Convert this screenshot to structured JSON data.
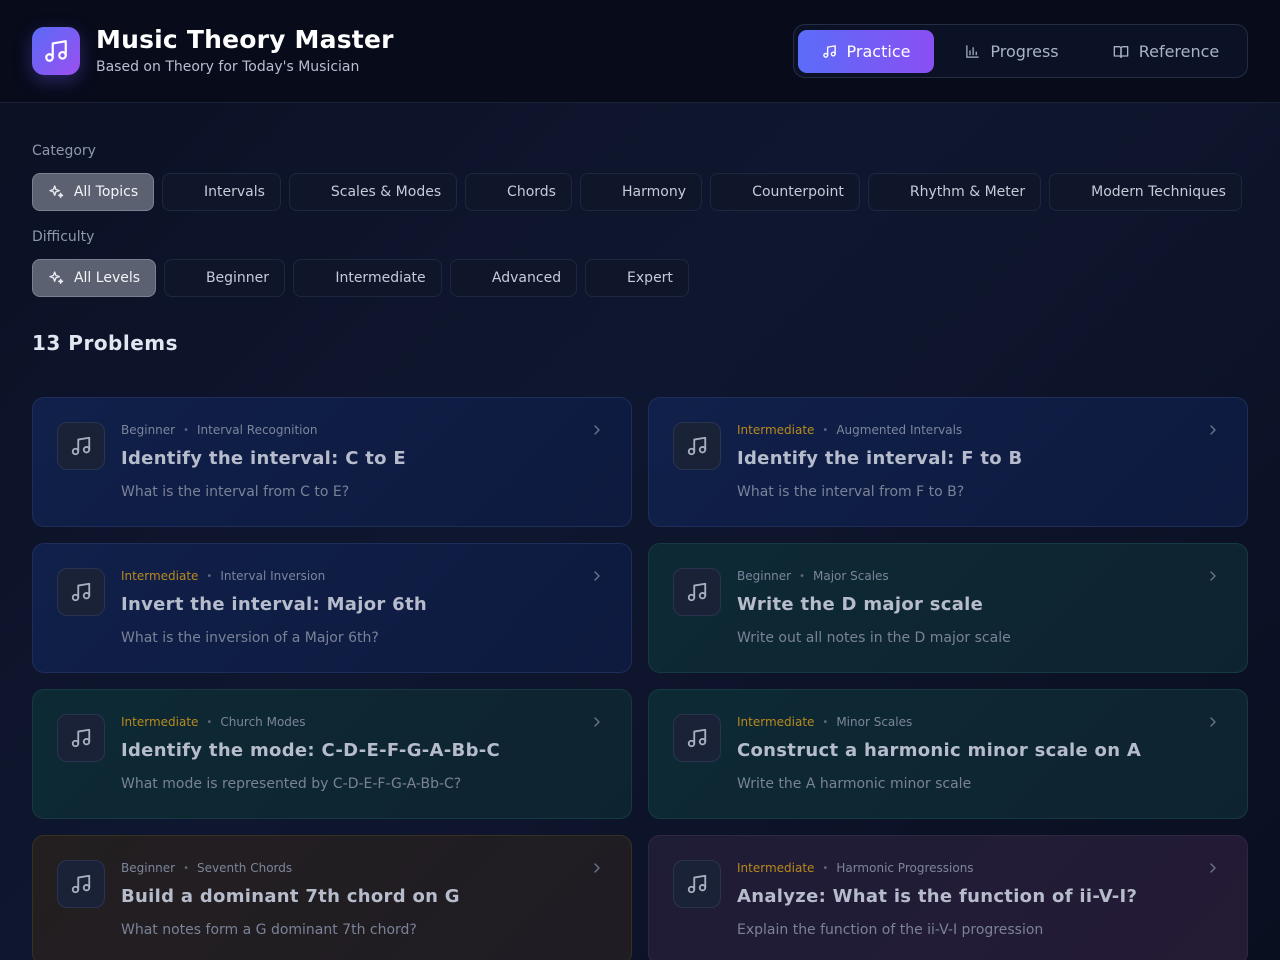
{
  "header": {
    "title": "Music Theory Master",
    "subtitle": "Based on Theory for Today's Musician",
    "logo_icon": "music-note-icon"
  },
  "nav": {
    "tabs": [
      {
        "label": "Practice",
        "icon": "music-note-icon",
        "active": true
      },
      {
        "label": "Progress",
        "icon": "bar-chart-icon",
        "active": false
      },
      {
        "label": "Reference",
        "icon": "book-icon",
        "active": false
      }
    ]
  },
  "filters": {
    "category_label": "Category",
    "categories": [
      {
        "label": "All Topics",
        "active": true
      },
      {
        "label": "Intervals",
        "active": false
      },
      {
        "label": "Scales & Modes",
        "active": false
      },
      {
        "label": "Chords",
        "active": false
      },
      {
        "label": "Harmony",
        "active": false
      },
      {
        "label": "Counterpoint",
        "active": false
      },
      {
        "label": "Rhythm & Meter",
        "active": false
      },
      {
        "label": "Modern Techniques",
        "active": false
      }
    ],
    "difficulty_label": "Difficulty",
    "levels": [
      {
        "label": "All Levels",
        "active": true
      },
      {
        "label": "Beginner",
        "active": false
      },
      {
        "label": "Intermediate",
        "active": false
      },
      {
        "label": "Advanced",
        "active": false
      },
      {
        "label": "Expert",
        "active": false
      }
    ]
  },
  "problems": {
    "count_label": "13 Problems",
    "items": [
      {
        "level": "Beginner",
        "topic": "Interval Recognition",
        "title": "Identify the interval: C to E",
        "desc": "What is the interval from C to E?",
        "theme": "blue"
      },
      {
        "level": "Intermediate",
        "topic": "Augmented Intervals",
        "title": "Identify the interval: F to B",
        "desc": "What is the interval from F to B?",
        "theme": "blue"
      },
      {
        "level": "Intermediate",
        "topic": "Interval Inversion",
        "title": "Invert the interval: Major 6th",
        "desc": "What is the inversion of a Major 6th?",
        "theme": "blue"
      },
      {
        "level": "Beginner",
        "topic": "Major Scales",
        "title": "Write the D major scale",
        "desc": "Write out all notes in the D major scale",
        "theme": "teal"
      },
      {
        "level": "Intermediate",
        "topic": "Church Modes",
        "title": "Identify the mode: C-D-E-F-G-A-Bb-C",
        "desc": "What mode is represented by C-D-E-F-G-A-Bb-C?",
        "theme": "teal"
      },
      {
        "level": "Intermediate",
        "topic": "Minor Scales",
        "title": "Construct a harmonic minor scale on A",
        "desc": "Write the A harmonic minor scale",
        "theme": "teal"
      },
      {
        "level": "Beginner",
        "topic": "Seventh Chords",
        "title": "Build a dominant 7th chord on G",
        "desc": "What notes form a G dominant 7th chord?",
        "theme": "amber"
      },
      {
        "level": "Intermediate",
        "topic": "Harmonic Progressions",
        "title": "Analyze: What is the function of ii-V-I?",
        "desc": "Explain the function of the ii-V-I progression",
        "theme": "purple"
      }
    ]
  },
  "colors": {
    "accent_start": "#5b6cf8",
    "accent_end": "#8a4ff2",
    "intermediate": "#b8891d"
  }
}
